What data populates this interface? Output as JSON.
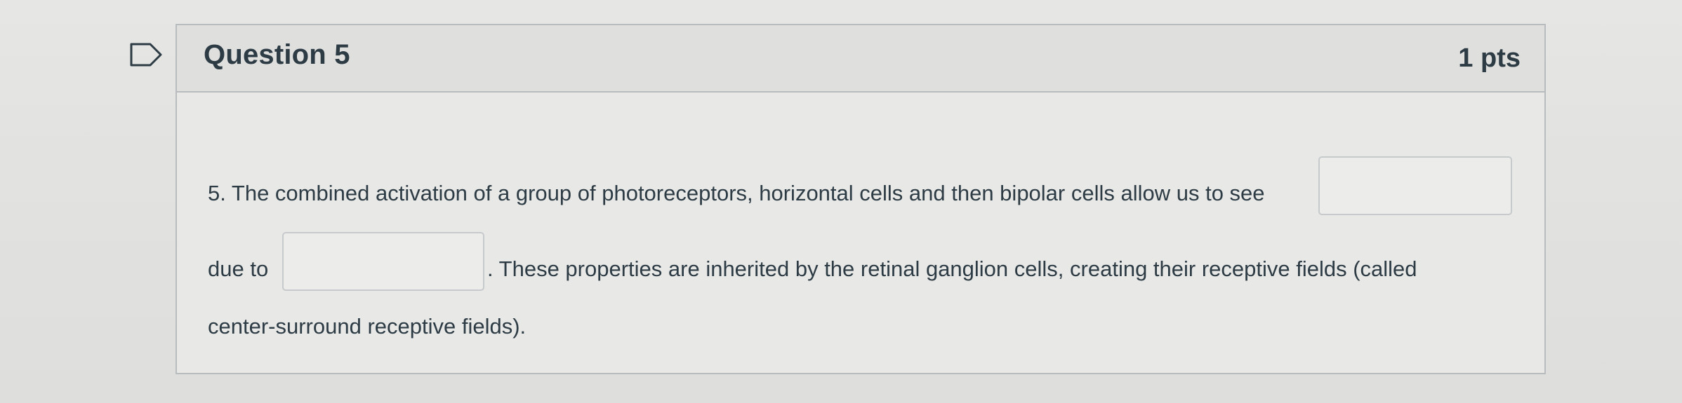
{
  "question": {
    "title": "Question 5",
    "points": "1 pts",
    "flag_icon": "flag-icon",
    "text_part1": "5. The combined activation of a group of photoreceptors, horizontal cells and then bipolar cells allow us to see",
    "text_part2": "due to",
    "text_part3": ". These properties are inherited by the retinal ganglion cells, creating their receptive ﬁelds (called",
    "text_part4": "center-surround receptive ﬁelds).",
    "blank1_value": "",
    "blank2_value": ""
  }
}
